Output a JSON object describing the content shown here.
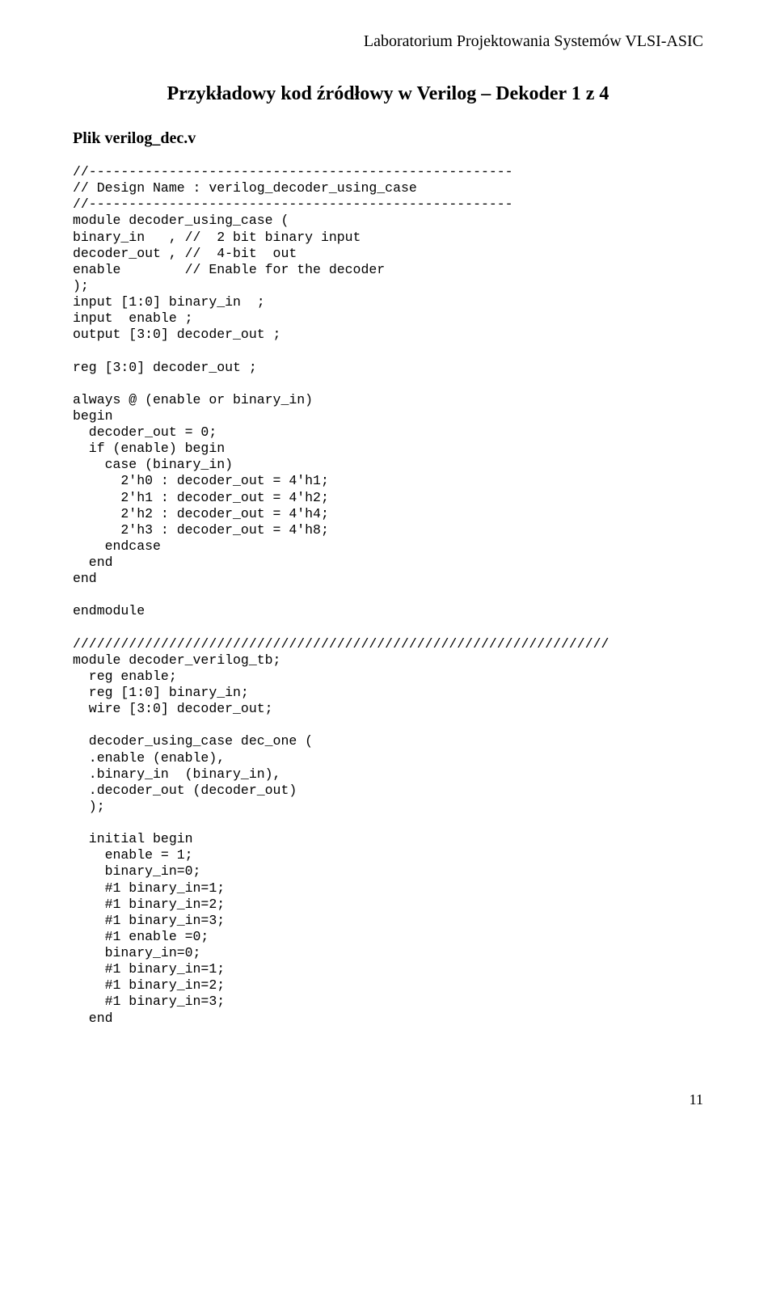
{
  "header": "Laboratorium Projektowania Systemów VLSI-ASIC",
  "title": "Przykładowy kod źródłowy w Verilog – Dekoder 1 z 4",
  "section_heading": "Plik verilog_dec.v",
  "code": "//-----------------------------------------------------\n// Design Name : verilog_decoder_using_case\n//-----------------------------------------------------\nmodule decoder_using_case (\nbinary_in   , //  2 bit binary input\ndecoder_out , //  4-bit  out\nenable        // Enable for the decoder\n);\ninput [1:0] binary_in  ;\ninput  enable ;\noutput [3:0] decoder_out ;\n\nreg [3:0] decoder_out ;\n\nalways @ (enable or binary_in)\nbegin\n  decoder_out = 0;\n  if (enable) begin\n    case (binary_in)\n      2'h0 : decoder_out = 4'h1;\n      2'h1 : decoder_out = 4'h2;\n      2'h2 : decoder_out = 4'h4;\n      2'h3 : decoder_out = 4'h8;\n    endcase\n  end\nend\n\nendmodule\n\n///////////////////////////////////////////////////////////////////\nmodule decoder_verilog_tb;\n  reg enable;\n  reg [1:0] binary_in;\n  wire [3:0] decoder_out;\n\n  decoder_using_case dec_one (\n  .enable (enable),\n  .binary_in  (binary_in),\n  .decoder_out (decoder_out)\n  );\n\n  initial begin\n    enable = 1;\n    binary_in=0;\n    #1 binary_in=1;\n    #1 binary_in=2;\n    #1 binary_in=3;\n    #1 enable =0;\n    binary_in=0;\n    #1 binary_in=1;\n    #1 binary_in=2;\n    #1 binary_in=3;\n  end",
  "page_number": "11"
}
